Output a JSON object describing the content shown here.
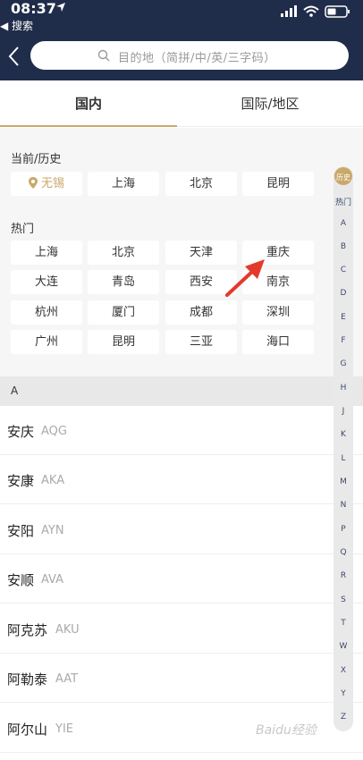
{
  "status": {
    "time": "08:37",
    "back_app": "◀ 搜索"
  },
  "search": {
    "placeholder": "目的地（简拼/中/英/三字码）"
  },
  "tabs": [
    {
      "label": "国内",
      "active": true
    },
    {
      "label": "国际/地区",
      "active": false
    }
  ],
  "history": {
    "title": "当前/历史",
    "cities": [
      "无锡",
      "上海",
      "北京",
      "昆明"
    ]
  },
  "hot": {
    "title": "热门",
    "cities": [
      "上海",
      "北京",
      "天津",
      "重庆",
      "大连",
      "青岛",
      "西安",
      "南京",
      "杭州",
      "厦门",
      "成都",
      "深圳",
      "广州",
      "昆明",
      "三亚",
      "海口"
    ]
  },
  "list": {
    "letter": "A",
    "rows": [
      {
        "name": "安庆",
        "code": "AQG"
      },
      {
        "name": "安康",
        "code": "AKA"
      },
      {
        "name": "安阳",
        "code": "AYN"
      },
      {
        "name": "安顺",
        "code": "AVA"
      },
      {
        "name": "阿克苏",
        "code": "AKU"
      },
      {
        "name": "阿勒泰",
        "code": "AAT"
      },
      {
        "name": "阿尔山",
        "code": "YIE"
      }
    ]
  },
  "index": [
    "历史",
    "热门",
    "A",
    "B",
    "C",
    "D",
    "E",
    "F",
    "G",
    "H",
    "J",
    "K",
    "L",
    "M",
    "N",
    "P",
    "Q",
    "R",
    "S",
    "T",
    "W",
    "X",
    "Y",
    "Z"
  ],
  "watermark": "Baidu经验",
  "colors": {
    "header": "#1f2d4a",
    "accent": "#c9a86a",
    "annotation": "#e23a2a"
  }
}
